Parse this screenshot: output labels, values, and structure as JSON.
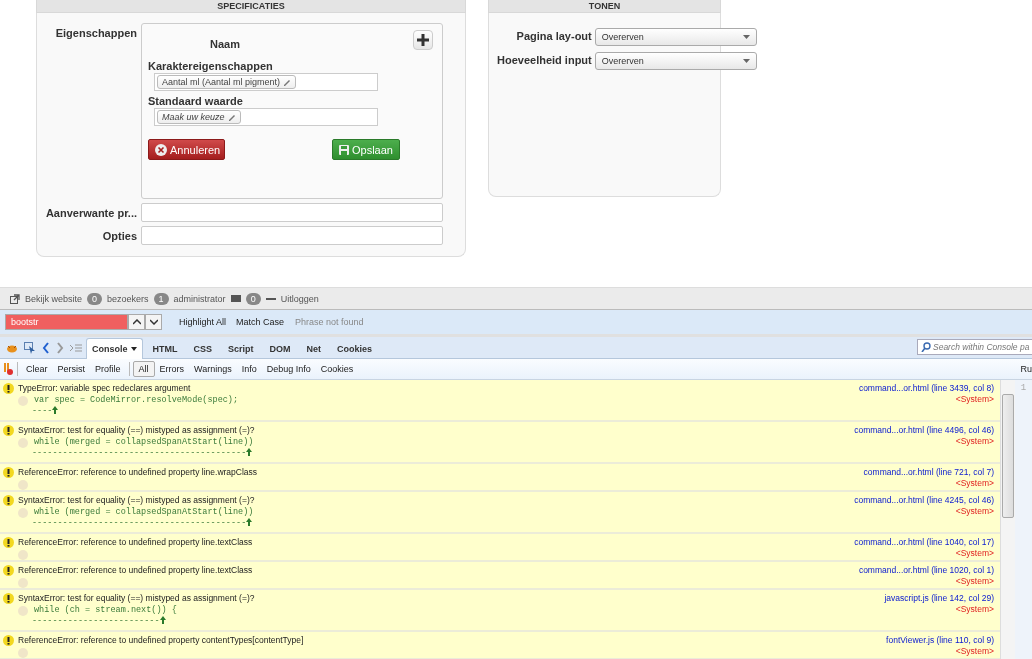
{
  "specificaties": {
    "title": "SPECIFICATIES",
    "properties_label": "Eigenschappen",
    "editor": {
      "name_label": "Naam",
      "characteristics_label": "Karaktereigenschappen",
      "characteristic_tag": "Aantal ml (Aantal ml pigment)",
      "default_label": "Standaard waarde",
      "default_tag": "Maak uw keuze",
      "cancel_button": "Annuleren",
      "save_button": "Opslaan"
    },
    "fields": [
      {
        "label": "Aanverwante pr..."
      },
      {
        "label": "Opties"
      }
    ]
  },
  "tonen": {
    "title": "TONEN",
    "selects": [
      {
        "label": "Pagina lay-out",
        "value": "Overerven"
      },
      {
        "label": "Hoeveelheid input",
        "value": "Overerven"
      }
    ]
  },
  "admin_bar": {
    "items": [
      {
        "kind": "link",
        "text": "Bekijk website"
      },
      {
        "kind": "count",
        "count": "0",
        "text": "bezoekers"
      },
      {
        "kind": "count",
        "count": "1",
        "text": "administrator"
      },
      {
        "kind": "mail",
        "count": "0"
      },
      {
        "kind": "logout",
        "text": "Uitloggen"
      }
    ]
  },
  "find_bar": {
    "value": "bootstr",
    "not_found": true,
    "options": [
      "Highlight All",
      "Match Case"
    ],
    "status": "Phrase not found"
  },
  "devtools": {
    "tabs": [
      {
        "label": "Console",
        "selected": true,
        "dropdown": true
      },
      {
        "label": "HTML",
        "selected": false,
        "dropdown": false
      },
      {
        "label": "CSS",
        "selected": false,
        "dropdown": false
      },
      {
        "label": "Script",
        "selected": false,
        "dropdown": false
      },
      {
        "label": "DOM",
        "selected": false,
        "dropdown": false
      },
      {
        "label": "Net",
        "selected": false,
        "dropdown": false
      },
      {
        "label": "Cookies",
        "selected": false,
        "dropdown": false
      }
    ],
    "search_placeholder": "Search within Console pa",
    "actions": [
      "Clear",
      "Persist",
      "Profile"
    ],
    "filters": [
      {
        "label": "All",
        "selected": true
      },
      {
        "label": "Errors",
        "selected": false
      },
      {
        "label": "Warnings",
        "selected": false
      },
      {
        "label": "Info",
        "selected": false
      },
      {
        "label": "Debug Info",
        "selected": false
      },
      {
        "label": "Cookies",
        "selected": false
      }
    ],
    "right_edge_text": "Ru",
    "gutter_line": "1",
    "log": [
      {
        "message": "TypeError: variable spec redeclares argument",
        "code": "var spec = CodeMirror.resolveMode(spec);",
        "pointer": "----",
        "source": "command...or.html (line 3439, col 8)",
        "origin": "<System>"
      },
      {
        "message": "SyntaxError: test for equality (==) mistyped as assignment (=)?",
        "code": "while (merged = collapsedSpanAtStart(line))",
        "pointer": "------------------------------------------",
        "source": "command...or.html (line 4496, col 46)",
        "origin": "<System>"
      },
      {
        "message": "ReferenceError: reference to undefined property line.wrapClass",
        "source": "command...or.html (line 721, col 7)",
        "origin": "<System>"
      },
      {
        "message": "SyntaxError: test for equality (==) mistyped as assignment (=)?",
        "code": "while (merged = collapsedSpanAtStart(line))",
        "pointer": "------------------------------------------",
        "source": "command...or.html (line 4245, col 46)",
        "origin": "<System>"
      },
      {
        "message": "ReferenceError: reference to undefined property line.textClass",
        "source": "command...or.html (line 1040, col 17)",
        "origin": "<System>"
      },
      {
        "message": "ReferenceError: reference to undefined property line.textClass",
        "source": "command...or.html (line 1020, col 1)",
        "origin": "<System>"
      },
      {
        "message": "SyntaxError: test for equality (==) mistyped as assignment (=)?",
        "code": "while (ch = stream.next()) {",
        "pointer": "-------------------------",
        "source": "javascript.js (line 142, col 29)",
        "origin": "<System>"
      },
      {
        "message": "ReferenceError: reference to undefined property contentTypes[contentType]",
        "source": "fontViewer.js (line 110, col 9)",
        "origin": "<System>"
      }
    ]
  }
}
